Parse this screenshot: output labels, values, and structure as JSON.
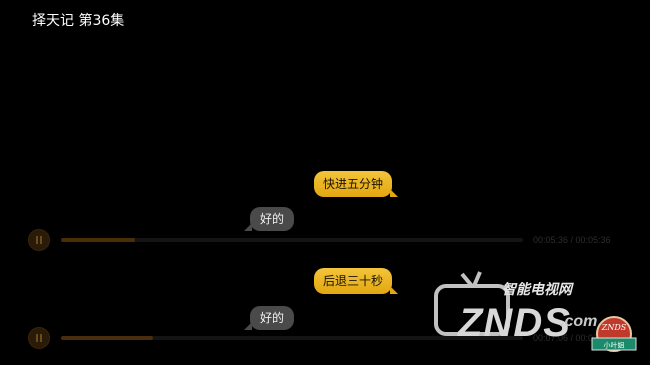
{
  "header": {
    "title": "择天记 第36集"
  },
  "conversation": [
    {
      "command": "快进五分钟",
      "reply": "好的",
      "player": {
        "progress": 0.16,
        "time": "00:05:36 / 00:05:36",
        "pause_icon": "pause-icon"
      }
    },
    {
      "command": "后退三十秒",
      "reply": "好的",
      "player": {
        "progress": 0.2,
        "time": "00:07:06 / 00:07:06",
        "pause_icon": "pause-icon"
      }
    }
  ],
  "watermark": {
    "site_cn": "智能电视网",
    "brand": "ZNDS",
    "domain": ".com",
    "badge_top": "ZNDS",
    "badge_bottom": "小叶姐"
  },
  "colors": {
    "user_bubble": "#f3c43a",
    "reply_bubble": "#4a4a4a",
    "progress_fill": "#4a2e0c"
  }
}
